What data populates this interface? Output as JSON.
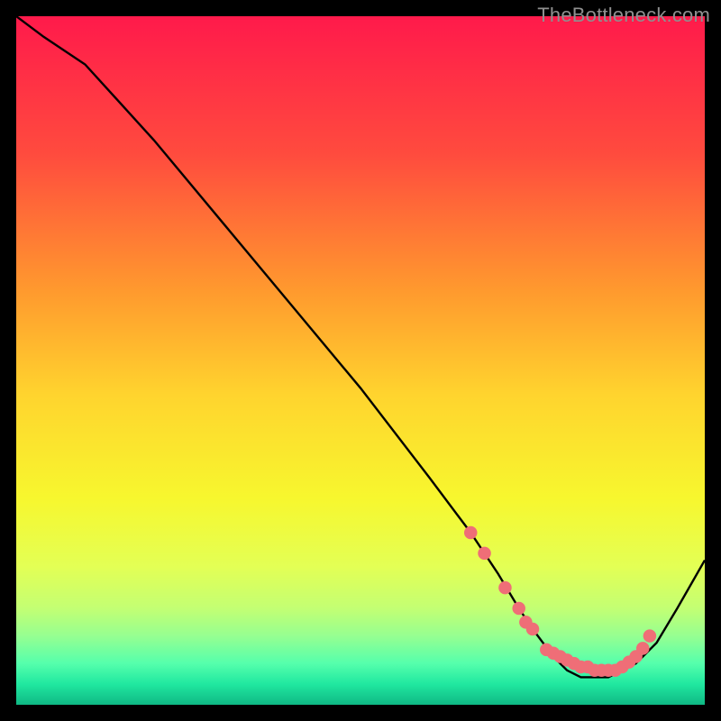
{
  "watermark": "TheBottleneck.com",
  "chart_data": {
    "type": "line",
    "title": "",
    "xlabel": "",
    "ylabel": "",
    "xlim": [
      0,
      100
    ],
    "ylim": [
      0,
      100
    ],
    "grid": false,
    "series": [
      {
        "name": "bottleneck-curve",
        "x": [
          0,
          4,
          10,
          20,
          30,
          40,
          50,
          60,
          66,
          70,
          73,
          75,
          78,
          80,
          82,
          84,
          86,
          88,
          90,
          93,
          96,
          100
        ],
        "y": [
          100,
          97,
          93,
          82,
          70,
          58,
          46,
          33,
          25,
          19,
          14,
          11,
          7,
          5,
          4,
          4,
          4,
          5,
          6,
          9,
          14,
          21
        ]
      }
    ],
    "markers": {
      "name": "highlight-points",
      "points": [
        {
          "x": 66,
          "y": 25
        },
        {
          "x": 68,
          "y": 22
        },
        {
          "x": 71,
          "y": 17
        },
        {
          "x": 73,
          "y": 14
        },
        {
          "x": 74,
          "y": 12
        },
        {
          "x": 75,
          "y": 11
        },
        {
          "x": 77,
          "y": 8
        },
        {
          "x": 78,
          "y": 7.5
        },
        {
          "x": 79,
          "y": 7
        },
        {
          "x": 80,
          "y": 6.5
        },
        {
          "x": 81,
          "y": 6
        },
        {
          "x": 82,
          "y": 5.5
        },
        {
          "x": 83,
          "y": 5.5
        },
        {
          "x": 84,
          "y": 5
        },
        {
          "x": 85,
          "y": 5
        },
        {
          "x": 86,
          "y": 5
        },
        {
          "x": 87,
          "y": 5
        },
        {
          "x": 88,
          "y": 5.5
        },
        {
          "x": 89,
          "y": 6.2
        },
        {
          "x": 90,
          "y": 7
        },
        {
          "x": 91,
          "y": 8.2
        },
        {
          "x": 92,
          "y": 10
        }
      ]
    },
    "background_gradient": {
      "stops": [
        {
          "pct": 0,
          "color": "#ff1a4b"
        },
        {
          "pct": 20,
          "color": "#ff4b3e"
        },
        {
          "pct": 40,
          "color": "#ff9a2e"
        },
        {
          "pct": 55,
          "color": "#ffd42e"
        },
        {
          "pct": 70,
          "color": "#f7f72e"
        },
        {
          "pct": 80,
          "color": "#e3ff55"
        },
        {
          "pct": 86,
          "color": "#c3ff73"
        },
        {
          "pct": 90,
          "color": "#96ff91"
        },
        {
          "pct": 94,
          "color": "#55ffac"
        },
        {
          "pct": 97,
          "color": "#20e8a0"
        },
        {
          "pct": 100,
          "color": "#0fb884"
        }
      ]
    },
    "marker_color": "#ef6e77",
    "line_color": "#000000"
  }
}
